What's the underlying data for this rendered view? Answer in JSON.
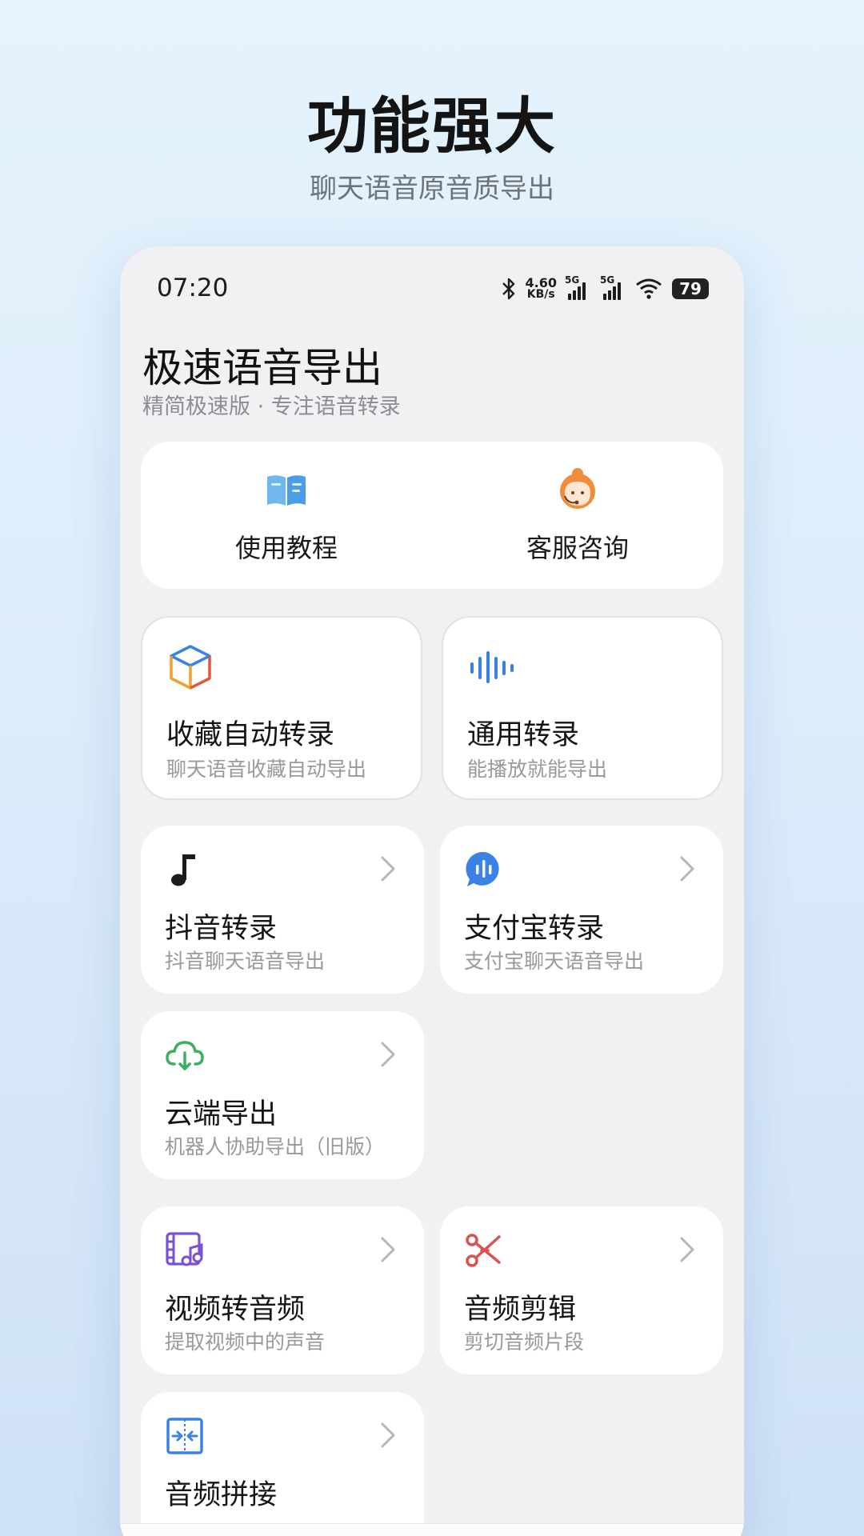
{
  "promo": {
    "title": "功能强大",
    "subtitle": "聊天语音原音质导出"
  },
  "status_bar": {
    "time": "07:20",
    "net_speed_value": "4.60",
    "net_speed_unit": "KB/s",
    "sim1_label": "5G",
    "sim2_label": "5G",
    "battery": "79",
    "icons": [
      "bluetooth-icon",
      "signal-icon",
      "signal-icon",
      "wifi-icon",
      "battery-icon"
    ]
  },
  "header": {
    "title": "极速语音导出",
    "subtitle": "精简极速版 · 专注语音转录"
  },
  "quick_actions": [
    {
      "label": "使用教程",
      "icon": "book-icon"
    },
    {
      "label": "客服咨询",
      "icon": "customer-service-icon"
    }
  ],
  "features": [
    {
      "name": "收藏自动转录",
      "desc": "聊天语音收藏自动导出",
      "icon": "cube-icon"
    },
    {
      "name": "通用转录",
      "desc": "能播放就能导出",
      "icon": "sound-wave-icon"
    },
    {
      "name": "抖音转录",
      "desc": "抖音聊天语音导出",
      "icon": "music-note-icon"
    },
    {
      "name": "支付宝转录",
      "desc": "支付宝聊天语音导出",
      "icon": "voice-bubble-icon"
    },
    {
      "name": "云端导出",
      "desc": "机器人协助导出（旧版）",
      "icon": "cloud-download-icon"
    },
    {
      "name": "视频转音频",
      "desc": "提取视频中的声音",
      "icon": "video-music-icon"
    },
    {
      "name": "音频剪辑",
      "desc": "剪切音频片段",
      "icon": "scissors-icon"
    },
    {
      "name": "音频拼接",
      "desc": "",
      "icon": "merge-icon"
    }
  ],
  "colors": {
    "accent_blue": "#3b82e6",
    "orange": "#f08c3a",
    "green": "#3fae5e",
    "purple": "#7b4fd6",
    "red": "#d9534f"
  }
}
